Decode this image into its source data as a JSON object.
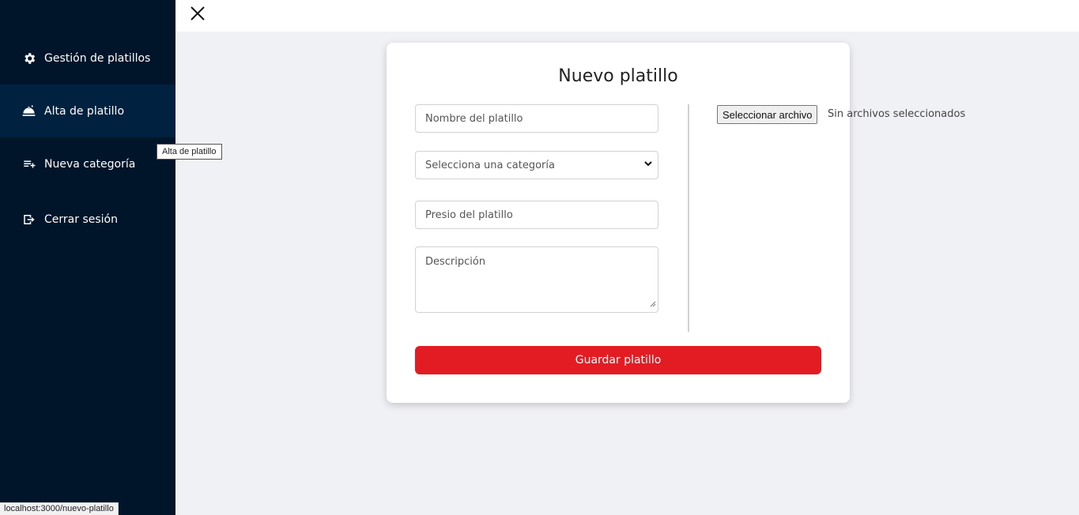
{
  "sidebar": {
    "items": [
      {
        "label": "Gestión de platillos",
        "icon": "gear-icon"
      },
      {
        "label": "Alta de platillo",
        "icon": "dish-icon"
      },
      {
        "label": "Nueva categoría",
        "icon": "playlist-add-icon"
      },
      {
        "label": "Cerrar sesión",
        "icon": "logout-icon"
      }
    ],
    "active_index": 1
  },
  "tooltip": "Alta de platillo",
  "topbar": {
    "close_icon": "close-icon"
  },
  "form": {
    "title": "Nuevo platillo",
    "name_placeholder": "Nombre del platillo",
    "category_selected": "Selecciona una categoría",
    "price_placeholder": "Presio del platillo",
    "description_placeholder": "Descripción",
    "file_button": "Seleccionar archivo",
    "file_status": "Sin archivos seleccionados",
    "save_label": "Guardar platillo"
  },
  "status_url": "localhost:3000/nuevo-platillo",
  "colors": {
    "sidebar_bg": "#001529",
    "sidebar_active": "#002140",
    "accent_red": "#e31b23",
    "page_bg": "#f0f1f5"
  }
}
